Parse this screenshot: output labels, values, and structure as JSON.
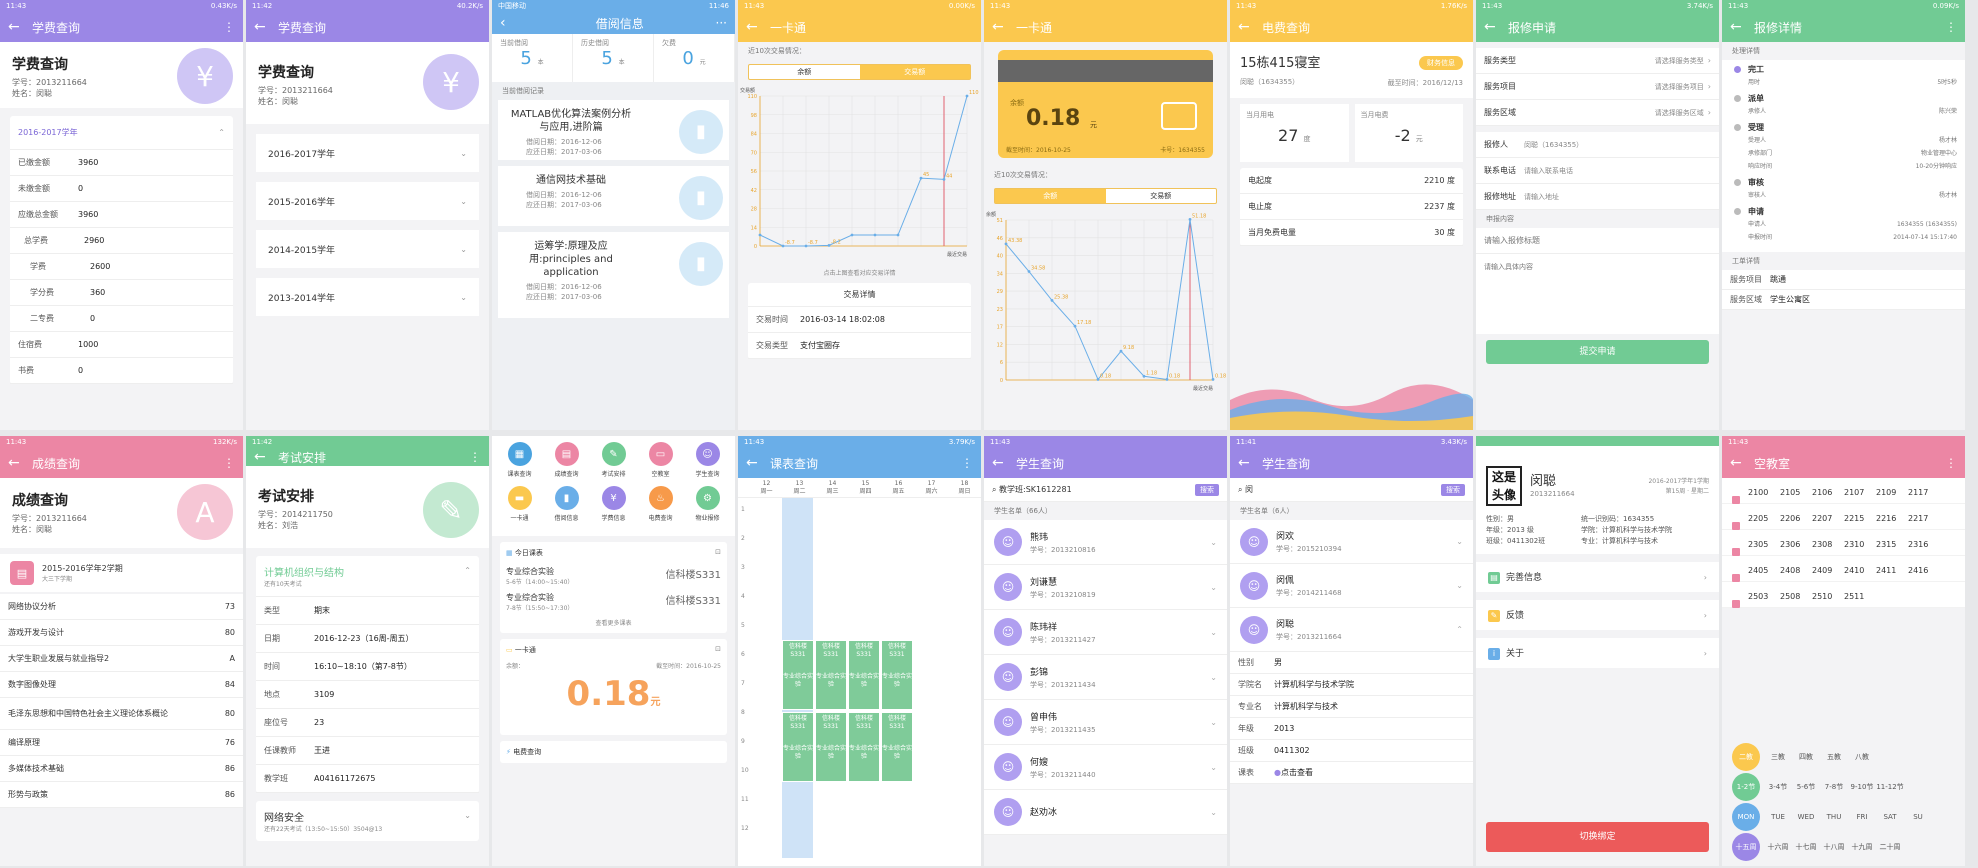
{
  "s1": {
    "status": {
      "time": "11:43",
      "net": "0.43K/s"
    },
    "title": "学费查询",
    "h1": "学费查询",
    "sid": "学号：2013211664",
    "name": "姓名：闵聪",
    "year": "2016-2017学年",
    "rows": [
      [
        "已缴金额",
        "3960"
      ],
      [
        "未缴金额",
        "0"
      ],
      [
        "应缴总金额",
        "3960"
      ],
      [
        "总学费",
        "2960"
      ],
      [
        "学费",
        "2600"
      ],
      [
        "学分费",
        "360"
      ],
      [
        "二专费",
        "0"
      ],
      [
        "住宿费",
        "1000"
      ],
      [
        "书费",
        "0"
      ]
    ]
  },
  "s2": {
    "status": {
      "time": "11:42",
      "net": "40.2K/s"
    },
    "title": "学费查询",
    "h1": "学费查询",
    "sid": "学号：2013211664",
    "name": "姓名：闵聪",
    "years": [
      "2016-2017学年",
      "2015-2016学年",
      "2014-2015学年",
      "2013-2014学年"
    ]
  },
  "s3": {
    "status": {
      "time": "11:46",
      "carrier": "中国移动"
    },
    "title": "借阅信息",
    "stats": [
      {
        "label": "当前借阅",
        "value": "5",
        "unit": "本"
      },
      {
        "label": "历史借阅",
        "value": "5",
        "unit": "本"
      },
      {
        "label": "欠费",
        "value": "0",
        "unit": "元"
      }
    ],
    "section": "当前借阅记录",
    "books": [
      {
        "title": "MATLAB优化算法案例分析与应用,进阶篇",
        "borrow": "借阅日期：2016-12-06",
        "ret": "应还日期：2017-03-06"
      },
      {
        "title": "通信网技术基础",
        "borrow": "借阅日期：2016-12-06",
        "ret": "应还日期：2017-03-06"
      },
      {
        "title": "运筹学:原理及应用:principles and application",
        "borrow": "借阅日期：2016-12-06",
        "ret": "应还日期：2017-03-06"
      }
    ]
  },
  "s4": {
    "status": {
      "time": "11:43",
      "net": "0.00K/s"
    },
    "title": "一卡通",
    "caption": "近10次交易情况：",
    "tabs": [
      "余额",
      "交易额"
    ],
    "yunit": "交易额",
    "xunit": "最近交易",
    "hint": "点击上图查看对应交易详情",
    "detail_title": "交易详情",
    "detail": [
      [
        "交易时间",
        "2016-03-14 18:02:08"
      ],
      [
        "交易类型",
        "支付宝圈存"
      ]
    ]
  },
  "s5": {
    "status": {
      "time": "11:43"
    },
    "title": "一卡通",
    "balance_label": "余额",
    "balance": "0.18",
    "balance_unit": "元",
    "as_of": "截至时间：2016-10-25",
    "card_no": "卡号：1634355",
    "caption": "近10次交易情况：",
    "tabs": [
      "余额",
      "交易额"
    ],
    "yunit": "余额",
    "xunit": "最近交易"
  },
  "s6": {
    "status": {
      "time": "11:43",
      "net": "1.76K/s"
    },
    "title": "电费查询",
    "room": "15栋415寝室",
    "owner": "闵聪（1634355）",
    "date": "截至时间：2016/12/13",
    "tag": "财务信息",
    "month_use_label": "当月用电",
    "month_use": "27",
    "month_use_unit": "度",
    "month_fee_label": "当月电费",
    "month_fee": "-2",
    "month_fee_unit": "元",
    "rows": [
      [
        "电起度",
        "2210 度"
      ],
      [
        "电止度",
        "2237 度"
      ],
      [
        "当月免费电量",
        "30 度"
      ]
    ]
  },
  "s7": {
    "status": {
      "time": "11:43",
      "net": "3.74K/s"
    },
    "title": "报修申请",
    "fields": [
      [
        "服务类型",
        "请选择服务类型"
      ],
      [
        "服务项目",
        "请选择服务项目"
      ],
      [
        "服务区域",
        "请选择服务区域"
      ]
    ],
    "fields2": [
      [
        "报修人",
        "闵聪（1634355）"
      ],
      [
        "联系电话",
        "请输入联系电话"
      ],
      [
        "报修地址",
        "请输入地址"
      ]
    ],
    "section": "申报内容",
    "ph_title": "请输入报修标题",
    "ph_content": "请输入具体内容",
    "submit": "提交申请"
  },
  "s8": {
    "status": {
      "time": "11:43",
      "net": "0.09K/s"
    },
    "title": "报修详情",
    "section": "处理详情",
    "steps": [
      {
        "name": "完工",
        "rows": [
          [
            "用时",
            "5时5秒"
          ]
        ]
      },
      {
        "name": "派单",
        "rows": [
          [
            "承修人",
            "陈兴荣"
          ]
        ]
      },
      {
        "name": "受理",
        "rows": [
          [
            "受理人",
            "杨才林"
          ],
          [
            "承修部门",
            "物业管理中心"
          ],
          [
            "响应时间",
            "10-20分钟响应"
          ]
        ]
      },
      {
        "name": "审核",
        "rows": [
          [
            "审核人",
            "杨才林"
          ]
        ]
      },
      {
        "name": "申请",
        "rows": [
          [
            "申请人",
            "1634355 (1634355)"
          ],
          [
            "申报时间",
            "2014-07-14 15:17:40"
          ]
        ]
      }
    ],
    "section2": "工单详情",
    "order": [
      [
        "服务项目",
        "跳通"
      ],
      [
        "服务区域",
        "学生公寓区"
      ]
    ]
  },
  "s9": {
    "status": {
      "time": "11:43",
      "net": "132K/s"
    },
    "title": "成绩查询",
    "h1": "成绩查询",
    "sid": "学号：2013211664",
    "name": "姓名：闵聪",
    "term": "2015-2016学年2学期",
    "term_sub": "大三下学期",
    "grades": [
      [
        "网络协议分析",
        "73"
      ],
      [
        "游戏开发与设计",
        "80"
      ],
      [
        "大学生职业发展与就业指导2",
        "A"
      ],
      [
        "数字图像处理",
        "84"
      ],
      [
        "毛泽东思想和中国特色社会主义理论体系概论",
        "80"
      ],
      [
        "编译原理",
        "76"
      ],
      [
        "多媒体技术基础",
        "86"
      ],
      [
        "形势与政策",
        "86"
      ]
    ]
  },
  "s10": {
    "status": {
      "time": "11:42"
    },
    "title": "考试安排",
    "h1": "考试安排",
    "sid": "学号：2014211750",
    "name": "姓名：刘浩",
    "course": "计算机组织与结构",
    "remain": "还有10天考试",
    "rows": [
      [
        "类型",
        "期末"
      ],
      [
        "日期",
        "2016-12-23（16周-周五）"
      ],
      [
        "时间",
        "16:10~18:10（第7-8节）"
      ],
      [
        "地点",
        "3109"
      ],
      [
        "座位号",
        "23"
      ],
      [
        "任课教师",
        "王进"
      ],
      [
        "教学班",
        "A04161172675"
      ]
    ],
    "next": "网络安全",
    "next_sub": "还有22天考试（13:50~15:50）3504@13"
  },
  "s11": {
    "icons": [
      [
        "课表查询",
        "#4aa3df"
      ],
      [
        "成绩查询",
        "#ec86a4"
      ],
      [
        "考试安排",
        "#71cb94"
      ],
      [
        "空教室",
        "#ec86a4"
      ],
      [
        "学生查询",
        "#9b87e6"
      ],
      [
        "一卡通",
        "#fbc84e"
      ],
      [
        "借阅信息",
        "#6aaee8"
      ],
      [
        "学费信息",
        "#9b87e6"
      ],
      [
        "电费查询",
        "#f79a4a"
      ],
      [
        "物业报修",
        "#71cb94"
      ]
    ],
    "today": "今日课表",
    "c1": "专业综合实验",
    "c1t": "5-6节（14:00~15:40）",
    "c1r": "信科楼S331",
    "c2": "专业综合实验",
    "c2t": "7-8节（15:50~17:30）",
    "c2r": "信科楼S331",
    "more": "查看更多课表",
    "card": "一卡通",
    "bal_label": "余额：",
    "asof": "截至时间：2016-10-25",
    "bal": "0.18",
    "unit": "元",
    "elec": "电费查询"
  },
  "s12": {
    "status": {
      "time": "11:43",
      "net": "3.79K/s"
    },
    "title": "课表查询",
    "days": [
      [
        "12",
        "周一"
      ],
      [
        "13",
        "周二"
      ],
      [
        "14",
        "周三"
      ],
      [
        "15",
        "周四"
      ],
      [
        "16",
        "周五"
      ],
      [
        "17",
        "周六"
      ],
      [
        "18",
        "周日"
      ]
    ],
    "cell_room": "信科楼S331",
    "cell_name": "专业综合实验"
  },
  "s13": {
    "status": {
      "time": "11:43"
    },
    "title": "学生查询",
    "query": "教学班:SK1612281",
    "search": "搜索",
    "count": "学生名单（66人）",
    "students": [
      [
        "熊玮",
        "学号：2013210816"
      ],
      [
        "刘谦慧",
        "学号：2013210819"
      ],
      [
        "陈玮祥",
        "学号：2013211427"
      ],
      [
        "彭锦",
        "学号：2013211434"
      ],
      [
        "曾申伟",
        "学号：2013211435"
      ],
      [
        "何嫂",
        "学号：2013211440"
      ],
      [
        "赵劝冰",
        ""
      ]
    ]
  },
  "s14": {
    "status": {
      "time": "11:41",
      "net": "3.43K/s"
    },
    "title": "学生查询",
    "query": "闵",
    "search": "搜索",
    "count": "学生名单（6人）",
    "students": [
      [
        "闵欢",
        "学号：2015210394"
      ],
      [
        "闵佩",
        "学号：2014211468"
      ],
      [
        "闵聪",
        "学号：2013211664"
      ]
    ],
    "detail": [
      [
        "性别",
        "男"
      ],
      [
        "学院名",
        "计算机科学与技术学院"
      ],
      [
        "专业名",
        "计算机科学与技术"
      ],
      [
        "年级",
        "2013"
      ],
      [
        "班级",
        "0411302"
      ],
      [
        "课表",
        "点击查看"
      ]
    ]
  },
  "s15": {
    "avatar": "这是头像",
    "name": "闵聪",
    "sid": "2013211664",
    "term": "2016-2017学年1学期",
    "week": "第15周 · 星期二",
    "info": [
      [
        "性别：男",
        "统一识别码：1634355"
      ],
      [
        "年级：2013 级",
        "学院：计算机科学与技术学院"
      ],
      [
        "班级：0411302班",
        "专业：计算机科学与技术"
      ]
    ],
    "menu": [
      "完善信息",
      "反馈",
      "关于"
    ],
    "switch": "切换绑定"
  },
  "s16": {
    "status": {
      "time": "11:43"
    },
    "title": "空教室",
    "rows": [
      [
        "2100",
        "2105",
        "2106",
        "2107",
        "2109",
        "2117"
      ],
      [
        "2205",
        "2206",
        "2207",
        "2215",
        "2216",
        "2217"
      ],
      [
        "2305",
        "2306",
        "2308",
        "2310",
        "2315",
        "2316"
      ],
      [
        "2405",
        "2408",
        "2409",
        "2410",
        "2411",
        "2416"
      ],
      [
        "2503",
        "2508",
        "2510",
        "2511"
      ]
    ],
    "floors": [
      "二教",
      "三教",
      "四教",
      "五教",
      "八教"
    ],
    "periods": [
      "1-2节",
      "3-4节",
      "5-6节",
      "7-8节",
      "9-10节",
      "11-12节"
    ],
    "wdays": [
      "MON",
      "TUE",
      "WED",
      "THU",
      "FRI",
      "SAT",
      "SU"
    ],
    "weeks": [
      "十五周",
      "十六周",
      "十七周",
      "十八周",
      "十九周",
      "二十周"
    ]
  },
  "chart_data": [
    {
      "type": "line",
      "title": "",
      "xlabel": "最近交易",
      "ylabel": "交易额",
      "yticks": [
        "0",
        "14",
        "28",
        "42",
        "56",
        "70",
        "84",
        "98",
        "110"
      ],
      "values": [
        0,
        -8.7,
        -8.7,
        -8.2,
        0,
        0,
        0,
        45.0,
        44.0,
        110
      ],
      "labels": [
        "",
        "-8.7",
        "-8.7",
        "-8.2",
        "",
        "",
        "",
        "45",
        "44",
        "110"
      ],
      "ylim": [
        0,
        110
      ]
    },
    {
      "type": "line",
      "title": "",
      "xlabel": "最近交易",
      "ylabel": "余额",
      "yticks": [
        "0",
        "6",
        "12",
        "17",
        "23",
        "29",
        "34",
        "40",
        "46",
        "51"
      ],
      "values": [
        43.38,
        34.58,
        25.38,
        17.18,
        0.18,
        9.18,
        1.18,
        0.18,
        51.18,
        0.18
      ],
      "labels": [
        "43.38",
        "34.58",
        "25.38",
        "17.18",
        "0.18",
        "9.18",
        "1.18",
        "0.18",
        "51.18",
        "0.18"
      ],
      "ylim": [
        0,
        51
      ]
    }
  ]
}
